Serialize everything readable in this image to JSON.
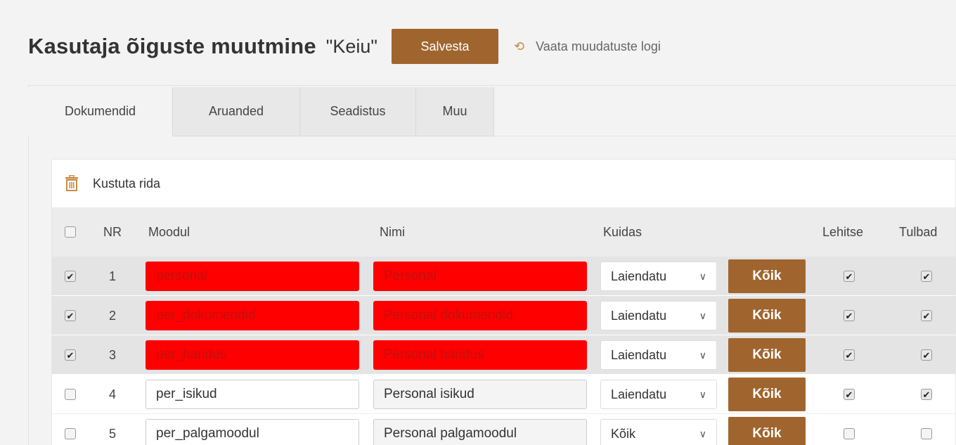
{
  "header": {
    "title": "Kasutaja õiguste muutmine",
    "user": "\"Keiu\"",
    "save_label": "Salvesta",
    "log_label": "Vaata muudatuste logi"
  },
  "tabs": [
    {
      "label": "Dokumendid",
      "active": true
    },
    {
      "label": "Aruanded",
      "active": false
    },
    {
      "label": "Seadistus",
      "active": false
    },
    {
      "label": "Muu",
      "active": false
    }
  ],
  "toolbar": {
    "delete_label": "Kustuta rida",
    "delete_icon": "trash-icon"
  },
  "columns": {
    "nr": "NR",
    "moodul": "Moodul",
    "nimi": "Nimi",
    "kuidas": "Kuidas",
    "lehitse": "Lehitse",
    "tulbad": "Tulbad"
  },
  "rows": [
    {
      "checked": true,
      "nr": "1",
      "moodul": "personal",
      "nimi": "Personal",
      "kuidas": "Laiendatu",
      "button": "Kõik",
      "lehitse": true,
      "tulbad": true,
      "highlight": true
    },
    {
      "checked": true,
      "nr": "2",
      "moodul": "per_dokumendid",
      "nimi": "Personal dokumendid",
      "kuidas": "Laiendatu",
      "button": "Kõik",
      "lehitse": true,
      "tulbad": true,
      "highlight": true
    },
    {
      "checked": true,
      "nr": "3",
      "moodul": "per_haridus",
      "nimi": "Personal haridus",
      "kuidas": "Laiendatu",
      "button": "Kõik",
      "lehitse": true,
      "tulbad": true,
      "highlight": true
    },
    {
      "checked": false,
      "nr": "4",
      "moodul": "per_isikud",
      "nimi": "Personal isikud",
      "kuidas": "Laiendatu",
      "button": "Kõik",
      "lehitse": true,
      "tulbad": true,
      "highlight": false
    },
    {
      "checked": false,
      "nr": "5",
      "moodul": "per_palgamoodul",
      "nimi": "Personal palgamoodul",
      "kuidas": "Kõik",
      "button": "Kõik",
      "lehitse": false,
      "tulbad": false,
      "highlight": false
    }
  ],
  "colors": {
    "accent": "#a0652e",
    "highlight": "#ff0000",
    "icon": "#c98a45"
  }
}
